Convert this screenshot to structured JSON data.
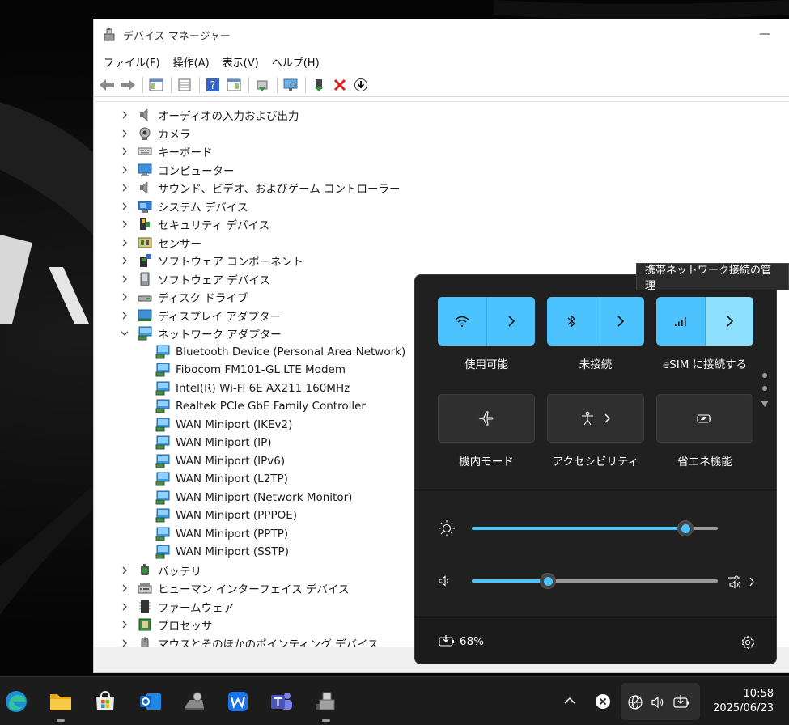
{
  "window": {
    "title": "デバイス マネージャー",
    "minimize_glyph": "—",
    "menu": [
      "ファイル(F)",
      "操作(A)",
      "表示(V)",
      "ヘルプ(H)"
    ]
  },
  "tree": [
    {
      "label": "オーディオの入力および出力",
      "icon": "speaker-icon",
      "expanded": false
    },
    {
      "label": "カメラ",
      "icon": "camera-icon",
      "expanded": false
    },
    {
      "label": "キーボード",
      "icon": "keyboard-icon",
      "expanded": false
    },
    {
      "label": "コンピューター",
      "icon": "computer-icon",
      "expanded": false
    },
    {
      "label": "サウンド、ビデオ、およびゲーム コントローラー",
      "icon": "speaker-icon",
      "expanded": false
    },
    {
      "label": "システム デバイス",
      "icon": "system-device-icon",
      "expanded": false
    },
    {
      "label": "セキュリティ デバイス",
      "icon": "security-device-icon",
      "expanded": false
    },
    {
      "label": "センサー",
      "icon": "sensor-icon",
      "expanded": false
    },
    {
      "label": "ソフトウェア コンポーネント",
      "icon": "software-component-icon",
      "expanded": false
    },
    {
      "label": "ソフトウェア デバイス",
      "icon": "software-device-icon",
      "expanded": false
    },
    {
      "label": "ディスク ドライブ",
      "icon": "disk-drive-icon",
      "expanded": false
    },
    {
      "label": "ディスプレイ アダプター",
      "icon": "display-adapter-icon",
      "expanded": false
    },
    {
      "label": "ネットワーク アダプター",
      "icon": "network-adapter-icon",
      "expanded": true
    },
    {
      "label": "Bluetooth Device (Personal Area Network)",
      "icon": "network-adapter-icon",
      "child": true
    },
    {
      "label": "Fibocom FM101-GL LTE Modem",
      "icon": "network-adapter-icon",
      "child": true
    },
    {
      "label": "Intel(R) Wi-Fi 6E AX211 160MHz",
      "icon": "network-adapter-icon",
      "child": true
    },
    {
      "label": "Realtek PCIe GbE Family Controller",
      "icon": "network-adapter-icon",
      "child": true
    },
    {
      "label": "WAN Miniport (IKEv2)",
      "icon": "network-adapter-icon",
      "child": true
    },
    {
      "label": "WAN Miniport (IP)",
      "icon": "network-adapter-icon",
      "child": true
    },
    {
      "label": "WAN Miniport (IPv6)",
      "icon": "network-adapter-icon",
      "child": true
    },
    {
      "label": "WAN Miniport (L2TP)",
      "icon": "network-adapter-icon",
      "child": true
    },
    {
      "label": "WAN Miniport (Network Monitor)",
      "icon": "network-adapter-icon",
      "child": true
    },
    {
      "label": "WAN Miniport (PPPOE)",
      "icon": "network-adapter-icon",
      "child": true
    },
    {
      "label": "WAN Miniport (PPTP)",
      "icon": "network-adapter-icon",
      "child": true
    },
    {
      "label": "WAN Miniport (SSTP)",
      "icon": "network-adapter-icon",
      "child": true
    },
    {
      "label": "バッテリ",
      "icon": "battery-icon",
      "expanded": false
    },
    {
      "label": "ヒューマン インターフェイス デバイス",
      "icon": "hid-icon",
      "expanded": false
    },
    {
      "label": "ファームウェア",
      "icon": "firmware-icon",
      "expanded": false
    },
    {
      "label": "プロセッサ",
      "icon": "processor-icon",
      "expanded": false
    },
    {
      "label": "マウスとそのほかのポインティング デバイス",
      "icon": "mouse-icon",
      "expanded": false
    }
  ],
  "tooltip": "携帯ネットワーク接続の管理",
  "quick_settings": {
    "wifi_label": "使用可能",
    "bluetooth_label": "未接続",
    "cellular_label": "eSIM に接続する",
    "airplane_label": "機内モード",
    "accessibility_label": "アクセシビリティ",
    "battery_saver_label": "省エネ機能",
    "brightness_level": 0.87,
    "volume_level": 0.31,
    "battery_percent": "68%",
    "page_dots": 2
  },
  "taskbar": {
    "apps": [
      "edge-icon",
      "file-explorer-icon",
      "store-icon",
      "outlook-icon",
      "device-settings-icon",
      "wps-icon",
      "teams-icon",
      "device-manager-icon"
    ],
    "time": "10:58",
    "date": "2025/06/23"
  },
  "colors": {
    "accent": "#4cc2ff",
    "accent_light": "#8ee0ff",
    "panel_bg": "#202020",
    "taskbar_bg": "#1c1c1c"
  }
}
